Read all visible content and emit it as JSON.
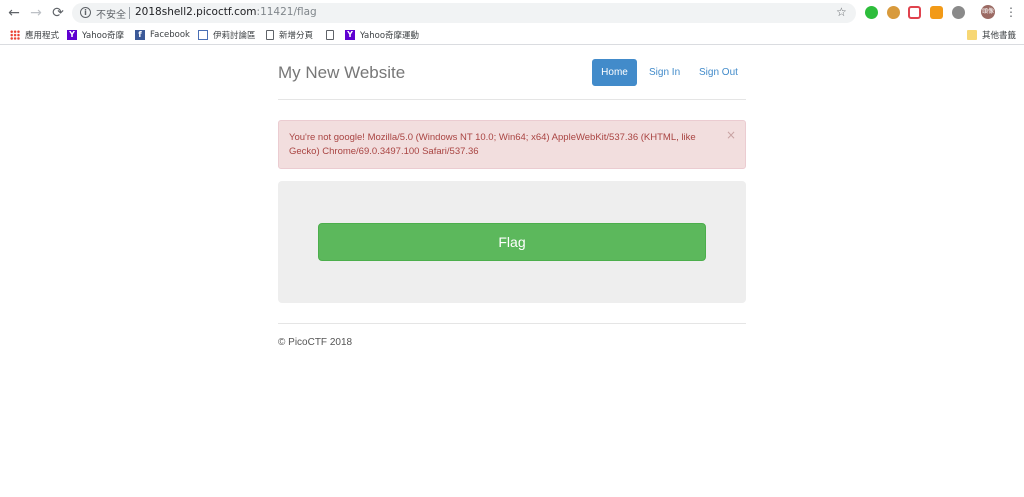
{
  "browser": {
    "security_label": "不安全",
    "url_host": "2018shell2.picoctf.com",
    "url_rest": ":11421/flag",
    "info_glyph": "i",
    "avatar_text": "頭像",
    "bookmarks": {
      "apps": "應用程式",
      "yahoo_auction": "Yahoo奇摩",
      "facebook": "Facebook",
      "forum": "伊莉討論區",
      "new_tab": "新增分頁",
      "yahoo_sports": "Yahoo奇摩運動",
      "other_bookmarks": "其他書籤"
    },
    "icons": [
      "back-icon",
      "forward-icon",
      "reload-icon",
      "info-icon",
      "star-icon",
      "line-extension-icon",
      "cookie-extension-icon",
      "pocket-extension-icon",
      "honey-extension-icon",
      "extension-icon",
      "avatar",
      "menu-icon",
      "apps-icon",
      "yahoo-icon",
      "facebook-icon",
      "forum-icon",
      "page-icon",
      "folder-icon"
    ]
  },
  "site": {
    "title": "My New Website",
    "nav": {
      "home": "Home",
      "sign_in": "Sign In",
      "sign_out": "Sign Out"
    },
    "alert": {
      "message": "You're not google! Mozilla/5.0 (Windows NT 10.0; Win64; x64) AppleWebKit/537.36 (KHTML, like Gecko) Chrome/69.0.3497.100 Safari/537.36",
      "close": "×"
    },
    "flag_button": "Flag",
    "footer": "© PicoCTF 2018"
  },
  "colors": {
    "primary": "#428bca",
    "success": "#5cb85c",
    "danger_bg": "#f2dede",
    "danger_text": "#a94442"
  }
}
